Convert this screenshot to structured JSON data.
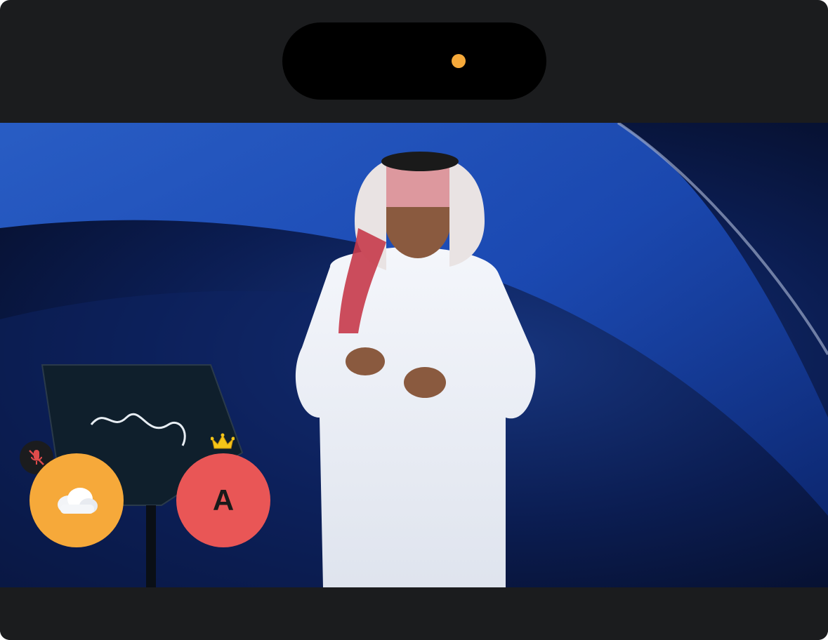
{
  "call": {
    "recording_indicator_color": "#f6a93a",
    "participants": [
      {
        "avatar": "cloud-icon",
        "avatar_color": "#f6a93a",
        "muted": true
      },
      {
        "avatar_letter": "A",
        "avatar_color": "#e95656",
        "host": true
      }
    ]
  },
  "colors": {
    "background": "#1b1c1e",
    "island": "#000000",
    "stage": "#0b1d52"
  }
}
